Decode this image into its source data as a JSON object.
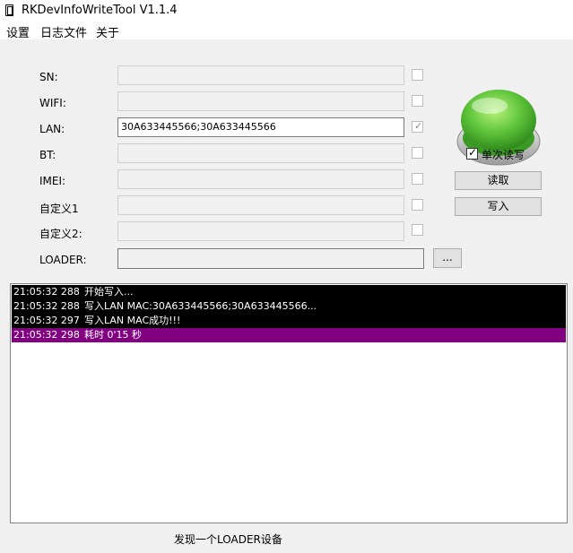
{
  "window": {
    "title": "RKDevInfoWriteTool V1.1.4"
  },
  "menu": [
    "设置",
    "日志文件",
    "关于"
  ],
  "fields": [
    {
      "label": "SN:",
      "value": "",
      "active": false,
      "checked": false
    },
    {
      "label": "WIFI:",
      "value": "",
      "active": false,
      "checked": false
    },
    {
      "label": "LAN:",
      "value": "30A633445566;30A633445566",
      "active": true,
      "checked": true
    },
    {
      "label": "BT:",
      "value": "",
      "active": false,
      "checked": false
    },
    {
      "label": "IMEI:",
      "value": "",
      "active": false,
      "checked": false
    },
    {
      "label": "自定义1",
      "value": "",
      "active": false,
      "checked": false
    },
    {
      "label": "自定义2:",
      "value": "",
      "active": false,
      "checked": false
    }
  ],
  "loader": {
    "label": "LOADER:",
    "value": "",
    "browse_label": "..."
  },
  "single_rw": {
    "label": "单次读写",
    "checked": true
  },
  "buttons": {
    "read": "读取",
    "write": "写入"
  },
  "log": [
    {
      "time": "21:05:32 288",
      "msg": "开始写入...",
      "style": "black"
    },
    {
      "time": "21:05:32 288",
      "msg": "写入LAN MAC:30A633445566;30A633445566...",
      "style": "black"
    },
    {
      "time": "21:05:32 297",
      "msg": "写入LAN MAC成功!!!",
      "style": "black"
    },
    {
      "time": "21:05:32 298",
      "msg": "耗时 0'15 秒",
      "style": "purple"
    }
  ],
  "status": "发现一个LOADER设备",
  "colors": {
    "status_button_green": "#5ec43a",
    "log_highlight": "#800080"
  },
  "icons": {
    "app": "phone-icon",
    "status_indicator": "green-round-button-icon"
  }
}
